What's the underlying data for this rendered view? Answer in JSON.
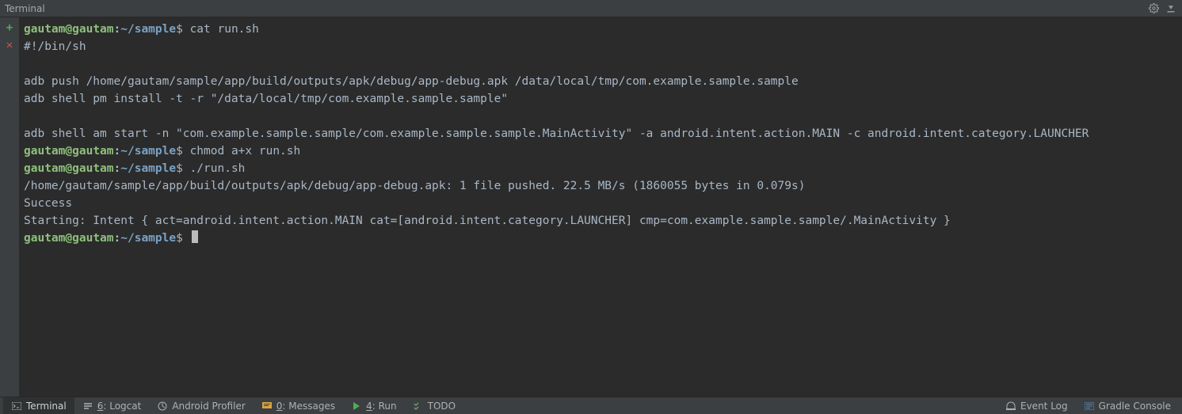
{
  "title": "Terminal",
  "prompt": {
    "user": "gautam",
    "host": "gautam",
    "tilde": "~",
    "path": "/sample",
    "sigil": "$"
  },
  "session": [
    {
      "type": "cmd",
      "text": "cat run.sh"
    },
    {
      "type": "out",
      "text": "#!/bin/sh"
    },
    {
      "type": "out",
      "text": ""
    },
    {
      "type": "out",
      "text": "adb push /home/gautam/sample/app/build/outputs/apk/debug/app-debug.apk /data/local/tmp/com.example.sample.sample"
    },
    {
      "type": "out",
      "text": "adb shell pm install -t -r \"/data/local/tmp/com.example.sample.sample\""
    },
    {
      "type": "out",
      "text": ""
    },
    {
      "type": "out",
      "text": "adb shell am start -n \"com.example.sample.sample/com.example.sample.sample.MainActivity\" -a android.intent.action.MAIN -c android.intent.category.LAUNCHER"
    },
    {
      "type": "cmd",
      "text": "chmod a+x run.sh"
    },
    {
      "type": "cmd",
      "text": "./run.sh"
    },
    {
      "type": "out",
      "text": "/home/gautam/sample/app/build/outputs/apk/debug/app-debug.apk: 1 file pushed. 22.5 MB/s (1860055 bytes in 0.079s)"
    },
    {
      "type": "out",
      "text": "Success"
    },
    {
      "type": "out",
      "text": "Starting: Intent { act=android.intent.action.MAIN cat=[android.intent.category.LAUNCHER] cmp=com.example.sample.sample/.MainActivity }"
    },
    {
      "type": "cmd",
      "text": "",
      "cursor": true
    }
  ],
  "bottom_tabs": {
    "terminal": "Terminal",
    "logcat_u": "6",
    "logcat": ": Logcat",
    "profiler": "Android Profiler",
    "messages_u": "0",
    "messages": ": Messages",
    "run_u": "4",
    "run": ": Run",
    "todo": "TODO"
  },
  "status_right": {
    "event_log": "Event Log",
    "gradle": "Gradle Console"
  }
}
